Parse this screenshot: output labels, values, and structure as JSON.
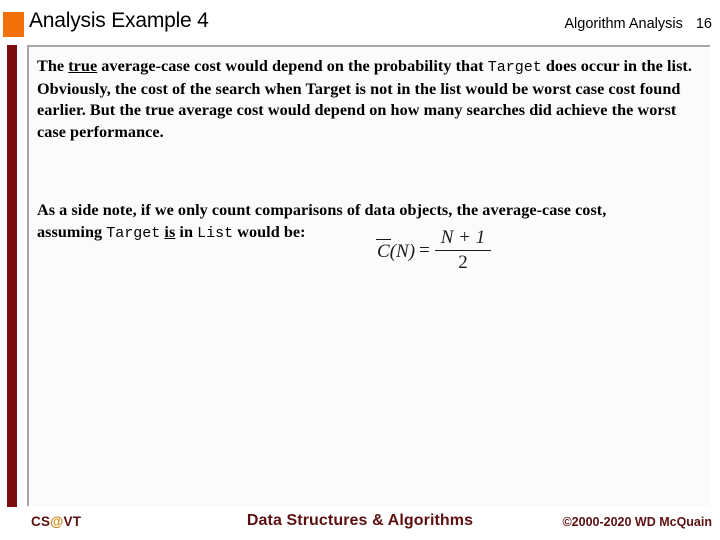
{
  "slide": {
    "title": "Analysis Example 4",
    "header_subject": "Algorithm Analysis",
    "slide_number": "16",
    "bullet_color": "#f2700a",
    "accent_bar_color": "#7a0d0d",
    "frame_border_color": "#a6a6a6"
  },
  "body": {
    "paragraph_1": {
      "seg_1": "The ",
      "seg_2_underlined": "true",
      "seg_3": " average-case cost would depend on the probability that ",
      "seg_4_mono": "Target",
      "seg_5": " does occur in the list.  Obviously, the cost of the search when Target is not in the list would be worst case cost found earlier.  But the true average cost would depend on how many searches did achieve the worst case performance."
    },
    "paragraph_2": {
      "seg_1": "As a side note, if we only count comparisons of data objects, the average-case cost, assuming ",
      "seg_2_mono": "Target",
      "seg_3_underlined": "is",
      "seg_4": " in ",
      "seg_5_mono": "List",
      "seg_6": " would be:"
    }
  },
  "equation": {
    "lhs_symbol": "C",
    "lhs_arg": "(N)",
    "relation": "=",
    "numerator": "N + 1",
    "denominator": "2",
    "plain_text": "C̅(N) = (N + 1) / 2"
  },
  "footer": {
    "left_prefix": "CS",
    "left_at": "@",
    "left_suffix": "VT",
    "center": "Data Structures & Algorithms",
    "right": "©2000-2020 WD McQuain",
    "text_color": "#5c1010",
    "at_color": "#d08a16"
  }
}
